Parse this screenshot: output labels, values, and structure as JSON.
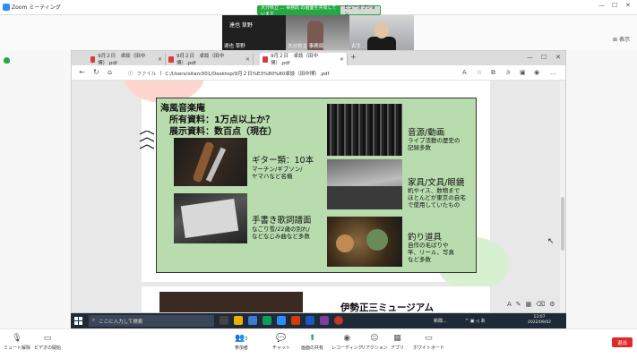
{
  "zoom": {
    "window_title": "Zoom ミーティング",
    "share_banner": "大分県立 ... 事務局 の画面を共有しています",
    "view_options": "ビューオプション",
    "view_button": "表示",
    "participants": [
      {
        "name": "達也 草野",
        "display": "達也 草野"
      },
      {
        "name": "大分県立 事務局"
      },
      {
        "name": "古生..."
      }
    ],
    "toolbar": {
      "unmute": "ミュート解除",
      "start_video": "ビデオの開始",
      "participants": "参加者",
      "participants_count": "5",
      "chat": "チャット",
      "share_screen": "画面の共有",
      "record": "レコーディング",
      "reactions": "リアクション",
      "apps": "アプリ",
      "whiteboard": "ホワイトボード",
      "end": "退出"
    }
  },
  "browser": {
    "tabs": [
      {
        "label": "9月２日　卓談（田中博）.pdf"
      },
      {
        "label": "9月２日　卓談（田中博）.pdf"
      },
      {
        "label": "9月２日　卓談（田中博）.pdf"
      }
    ],
    "address": {
      "label": "ファイル",
      "url": "C:/Users/oitarc001/Desktop/9月２日%E3%80%80卓談（田中博）.pdf"
    }
  },
  "slide1": {
    "title": "海風音楽庵",
    "line1": "所有資料：1万点以上か？",
    "line2": "展示資料：数百点（現在）",
    "items": [
      {
        "heading": "ギター類：10本",
        "desc": [
          "マーチン/ギブソン/",
          "ヤマハなど名機"
        ]
      },
      {
        "heading": "手書き歌詞譜面",
        "desc": [
          "なごり雪/22歳の別れ/",
          "などなじみ曲など多数"
        ]
      },
      {
        "heading": "音源/動画",
        "desc": [
          "ライブ活動の歴史の",
          "記録多数"
        ]
      },
      {
        "heading": "家具/文具/眼鏡",
        "desc": [
          "机やイス、数物まで",
          "ほとんどが東京の自宅",
          "で使用していたもの"
        ]
      },
      {
        "heading": "釣り道具",
        "desc": [
          "自作の毛ばりや",
          "竿、リール、写真",
          "など多数"
        ]
      }
    ]
  },
  "slide2": {
    "title": "伊勢正三ミュージアム"
  },
  "taskbar": {
    "search_placeholder": "ここに入力して検索",
    "news": "新聞...",
    "time": "13:07",
    "date": "2022/09/02"
  },
  "colors": {
    "panel_green": "#b8dcae",
    "zoom_green": "#23a942",
    "end_red": "#e02828"
  }
}
